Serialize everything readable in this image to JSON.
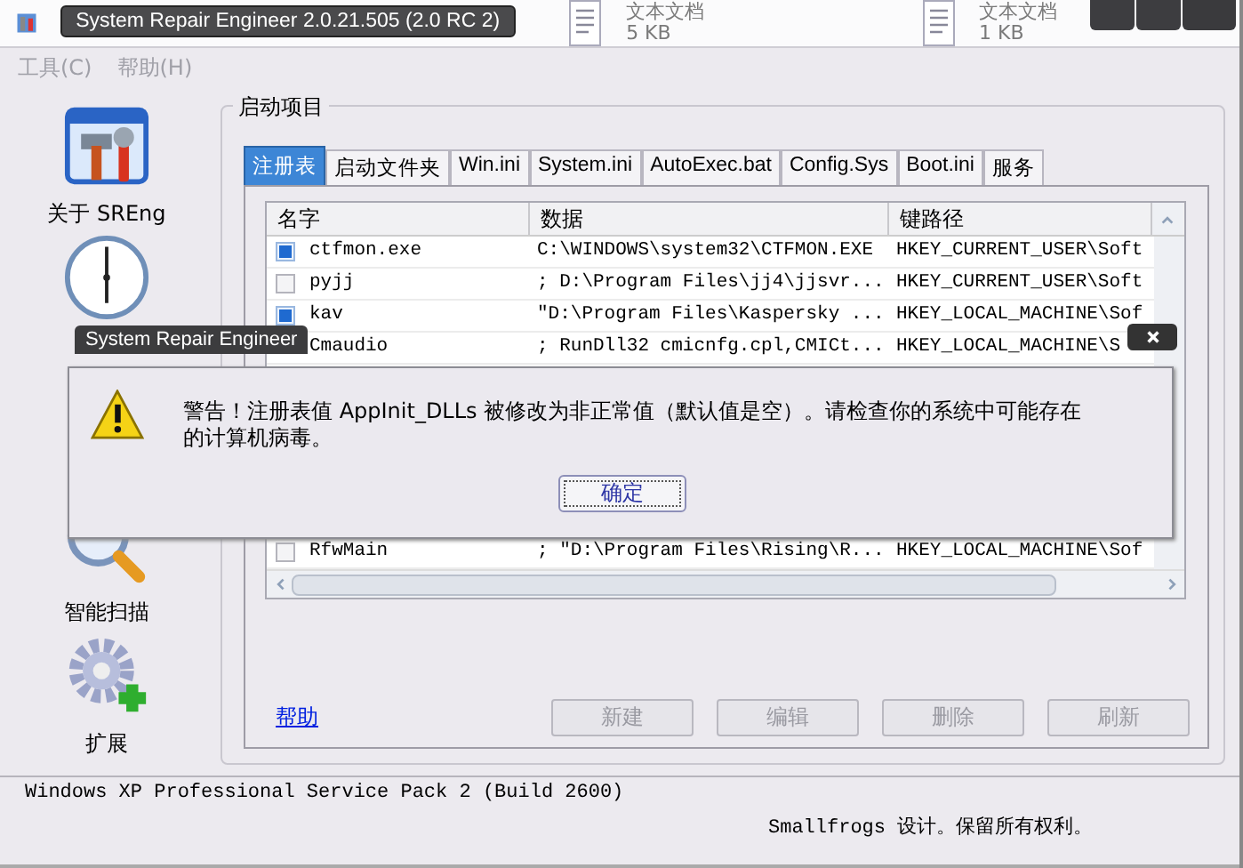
{
  "window": {
    "title": "System Repair Engineer 2.0.21.505 (2.0 RC 2)"
  },
  "desktop_files": [
    {
      "name": "文本文档",
      "size": "5 KB"
    },
    {
      "name": "文本文档",
      "size": "1 KB"
    }
  ],
  "menu": [
    {
      "label": "工具(C)",
      "disabled": true
    },
    {
      "label": "帮助(H)",
      "disabled": true
    }
  ],
  "sidebar": {
    "items": [
      {
        "kind": "tools",
        "label": "关于 SREng"
      },
      {
        "kind": "clock"
      },
      {
        "kind": "scan",
        "label": "智能扫描"
      },
      {
        "kind": "extend",
        "label": "扩展"
      }
    ]
  },
  "group_title": "启动项目",
  "tabs": [
    {
      "label": "注册表",
      "selected": true
    },
    {
      "label": "启动文件夹",
      "selected": false
    },
    {
      "label": "Win.ini",
      "selected": false
    },
    {
      "label": "System.ini",
      "selected": false
    },
    {
      "label": "AutoExec.bat",
      "selected": false
    },
    {
      "label": "Config.Sys",
      "selected": false
    },
    {
      "label": "Boot.ini",
      "selected": false
    },
    {
      "label": "服务",
      "selected": false
    }
  ],
  "table": {
    "columns": [
      "名字",
      "数据",
      "键路径"
    ],
    "rows": [
      {
        "checked": true,
        "cells": [
          "ctfmon.exe",
          "C:\\WINDOWS\\system32\\CTFMON.EXE",
          "HKEY_CURRENT_USER\\Soft"
        ]
      },
      {
        "checked": false,
        "cells": [
          "pyjj",
          "; D:\\Program Files\\jj4\\jjsvr...",
          "HKEY_CURRENT_USER\\Soft"
        ]
      },
      {
        "checked": true,
        "cells": [
          "kav",
          "\"D:\\Program Files\\Kaspersky ...",
          "HKEY_LOCAL_MACHINE\\Sof"
        ]
      },
      {
        "cells": [
          "Cmaudio",
          "; RunDll32 cmicnfg.cpl,CMICt...",
          "HKEY_LOCAL_MACHINE\\S"
        ]
      },
      {
        "checked": false,
        "cells": [
          "RfwMain",
          "; \"D:\\Program Files\\Rising\\R...",
          "HKEY_LOCAL_MACHINE\\Sof"
        ]
      }
    ]
  },
  "help_link": "帮助",
  "buttons": [
    {
      "label": "新建",
      "disabled": true
    },
    {
      "label": "编辑",
      "disabled": true
    },
    {
      "label": "删除",
      "disabled": true
    },
    {
      "label": "刷新",
      "disabled": true
    }
  ],
  "status_bar": {
    "os": "Windows XP Professional Service Pack 2 (Build 2600)",
    "copyright": "Smallfrogs 设计。保留所有权利。"
  },
  "dialog": {
    "title": "System Repair Engineer",
    "message": "警告！注册表值 AppInit_DLLs 被修改为非正常值（默认值是空）。请检查你的系统中可能存在的计算机病毒。",
    "button": "确定"
  }
}
